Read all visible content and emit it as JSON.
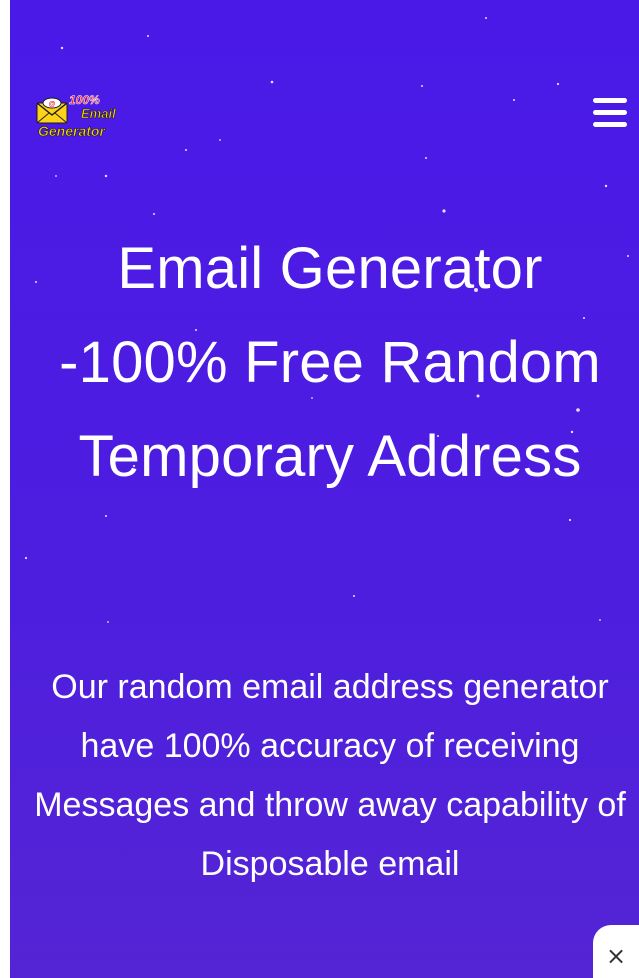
{
  "header": {
    "logo": {
      "icon": "email-generator-logo",
      "badge_text": "100%",
      "line1": "Email",
      "line2": "Generator"
    },
    "menu_icon": "hamburger-menu-icon"
  },
  "hero": {
    "title": "Email Generator -100% Free Random Temporary Address",
    "subtitle": "Our random email address generator have 100% accuracy of receiving Messages and throw away capability of Disposable email"
  },
  "close_button": {
    "label": "×",
    "icon": "close-icon"
  },
  "colors": {
    "hero_background": "#4a19e8",
    "text": "#ffffff",
    "logo_yellow": "#ffd21a",
    "logo_red": "#e4162b"
  }
}
